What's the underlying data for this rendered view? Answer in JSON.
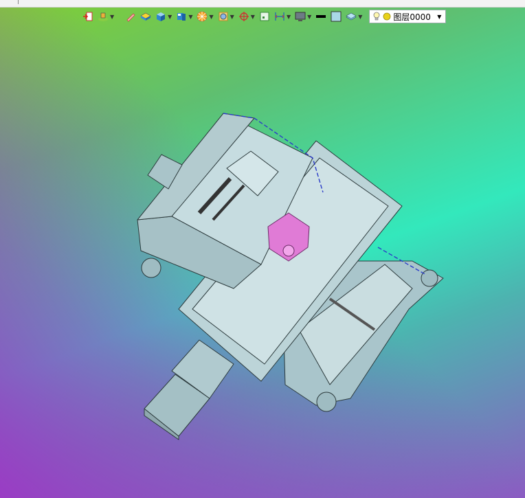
{
  "toolbar": {
    "buttons": [
      {
        "name": "import-icon",
        "dropdown": false
      },
      {
        "name": "layer-manager-icon",
        "dropdown": true
      },
      {
        "name": "pen-icon",
        "dropdown": false
      },
      {
        "name": "box-yellow-icon",
        "dropdown": false
      },
      {
        "name": "box-blue-icon",
        "dropdown": true
      },
      {
        "name": "view-cube-icon",
        "dropdown": true
      },
      {
        "name": "section-wheel-icon",
        "dropdown": true
      },
      {
        "name": "render-mode-icon",
        "dropdown": true
      },
      {
        "name": "crosshair-icon",
        "dropdown": true
      },
      {
        "name": "fit-view-icon",
        "dropdown": false
      },
      {
        "name": "ruler-icon",
        "dropdown": true
      },
      {
        "name": "display-icon",
        "dropdown": true
      },
      {
        "name": "line-color-icon",
        "dropdown": false
      },
      {
        "name": "fill-color-icon",
        "dropdown": false
      },
      {
        "name": "layers-stack-icon",
        "dropdown": true
      }
    ],
    "layer_select": {
      "value": "图层0000"
    }
  },
  "colors": {
    "model_fill": "#b9d2d6",
    "model_stroke": "#2c3a3c",
    "highlight_part": "#e07bd6",
    "edge_highlight": "#2b3cc8"
  }
}
